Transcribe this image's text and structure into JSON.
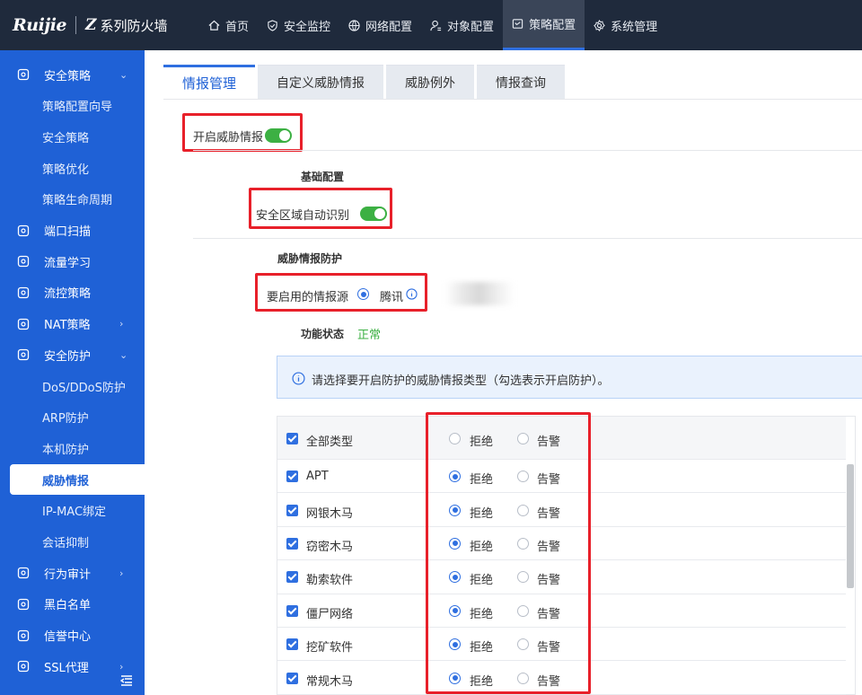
{
  "brand": {
    "logo": "Ruijie",
    "series_prefix": "Z",
    "series_text": "系列防火墙"
  },
  "nav": [
    {
      "label": "首页",
      "icon": "home-icon"
    },
    {
      "label": "安全监控",
      "icon": "shield-check-icon"
    },
    {
      "label": "网络配置",
      "icon": "globe-icon"
    },
    {
      "label": "对象配置",
      "icon": "user-object-icon"
    },
    {
      "label": "策略配置",
      "icon": "policy-icon",
      "active": true
    },
    {
      "label": "系统管理",
      "icon": "gear-icon"
    }
  ],
  "sidebar": [
    {
      "label": "安全策略",
      "icon": "shield-icon",
      "arrow": "⌄"
    },
    {
      "label": "策略配置向导",
      "sub": true
    },
    {
      "label": "安全策略",
      "sub": true
    },
    {
      "label": "策略优化",
      "sub": true
    },
    {
      "label": "策略生命周期",
      "sub": true
    },
    {
      "label": "端口扫描",
      "icon": "scan-icon"
    },
    {
      "label": "流量学习",
      "icon": "chart-icon"
    },
    {
      "label": "流控策略",
      "icon": "flow-control-icon"
    },
    {
      "label": "NAT策略",
      "icon": "nat-icon",
      "arrow": "›"
    },
    {
      "label": "安全防护",
      "icon": "protection-icon",
      "arrow": "⌄"
    },
    {
      "label": "DoS/DDoS防护",
      "sub": true
    },
    {
      "label": "ARP防护",
      "sub": true
    },
    {
      "label": "本机防护",
      "sub": true
    },
    {
      "label": "威胁情报",
      "sub": true,
      "active": true
    },
    {
      "label": "IP-MAC绑定",
      "sub": true
    },
    {
      "label": "会话抑制",
      "sub": true
    },
    {
      "label": "行为审计",
      "icon": "audit-icon",
      "arrow": "›"
    },
    {
      "label": "黑白名单",
      "icon": "blacklist-icon"
    },
    {
      "label": "信誉中心",
      "icon": "reputation-icon"
    },
    {
      "label": "SSL代理",
      "icon": "ssl-icon",
      "arrow": "›"
    }
  ],
  "tabs": [
    "情报管理",
    "自定义威胁情报",
    "威胁例外",
    "情报查询"
  ],
  "form": {
    "enable_label": "开启威胁情报",
    "enable_on": true,
    "basic_section": "基础配置",
    "zone_label": "安全区域自动识别",
    "zone_on": true,
    "protect_section": "威胁情报防护",
    "source_label": "要启用的情报源",
    "source_option": "腾讯",
    "status_label": "功能状态",
    "status_value": "正常"
  },
  "notice": "请选择要开启防护的威胁情报类型（勾选表示开启防护）。",
  "table": {
    "deny_label": "拒绝",
    "alert_label": "告警",
    "rows": [
      {
        "name": "全部类型",
        "checked": true,
        "action": "none"
      },
      {
        "name": "APT",
        "checked": true,
        "action": "deny"
      },
      {
        "name": "网银木马",
        "checked": true,
        "action": "deny"
      },
      {
        "name": "窃密木马",
        "checked": true,
        "action": "deny"
      },
      {
        "name": "勒索软件",
        "checked": true,
        "action": "deny"
      },
      {
        "name": "僵尸网络",
        "checked": true,
        "action": "deny"
      },
      {
        "name": "挖矿软件",
        "checked": true,
        "action": "deny"
      },
      {
        "name": "常规木马",
        "checked": true,
        "action": "deny"
      }
    ]
  },
  "colors": {
    "sidebar": "#1f61d6",
    "topbar": "#1f2a3c",
    "accent": "#2f6fe0",
    "toggle_on": "#3cb043",
    "highlight": "#e8202a"
  }
}
